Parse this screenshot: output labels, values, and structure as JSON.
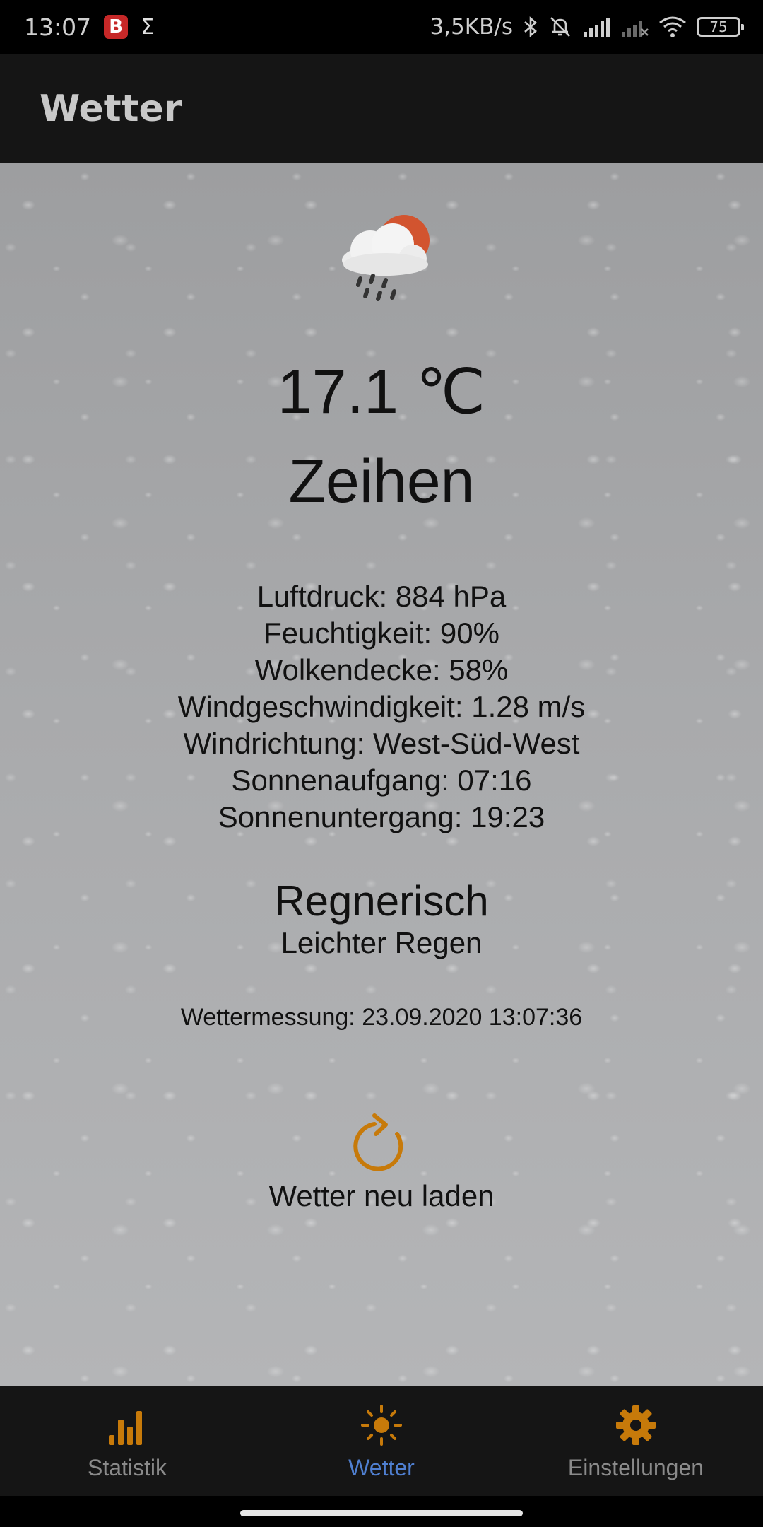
{
  "status_bar": {
    "time": "13:07",
    "badge_letter": "B",
    "sigma": "Σ",
    "network_speed": "3,5KB/s",
    "battery": "75"
  },
  "app_bar": {
    "title": "Wetter"
  },
  "weather": {
    "icon": "rain-cloud-sun-icon",
    "temperature": "17.1 ℃",
    "city": "Zeihen",
    "details": [
      "Luftdruck: 884 hPa",
      "Feuchtigkeit: 90%",
      "Wolkendecke: 58%",
      "Windgeschwindigkeit: 1.28 m/s",
      "Windrichtung: West-Süd-West",
      "Sonnenaufgang: 07:16",
      "Sonnenuntergang: 19:23"
    ],
    "condition": "Regnerisch",
    "condition_description": "Leichter Regen",
    "measurement": "Wettermessung: 23.09.2020 13:07:36"
  },
  "reload": {
    "label": "Wetter neu laden",
    "icon": "refresh-icon"
  },
  "bottom_nav": {
    "items": [
      {
        "label": "Statistik",
        "icon": "bar-chart-icon",
        "active": false
      },
      {
        "label": "Wetter",
        "icon": "sun-icon",
        "active": true
      },
      {
        "label": "Einstellungen",
        "icon": "gear-icon",
        "active": false
      }
    ]
  },
  "colors": {
    "accent": "#c77a0a",
    "active_nav": "#4f7fd0",
    "bar_background": "#151515"
  }
}
